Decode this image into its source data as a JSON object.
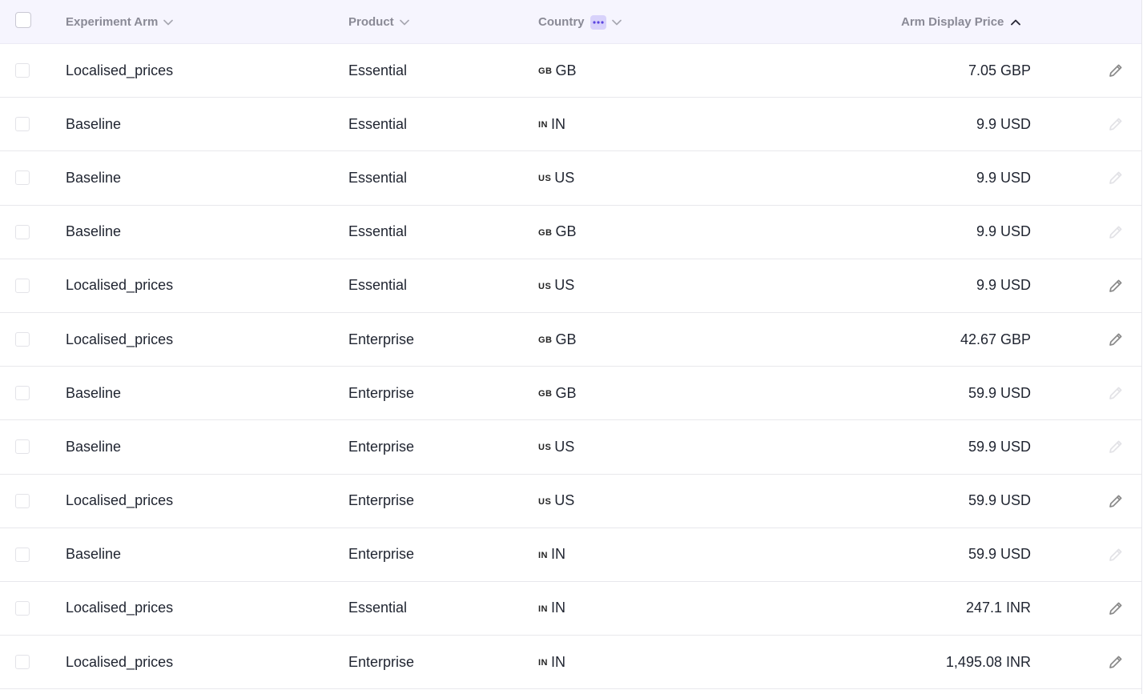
{
  "header": {
    "columns": {
      "arm": "Experiment Arm",
      "product": "Product",
      "country": "Country",
      "price": "Arm Display Price"
    }
  },
  "colors": {
    "header_bg": "#f6f5fe",
    "header_text": "#8a8a96",
    "accent": "#6c5ce7",
    "edit_active": "#888888",
    "edit_disabled": "#e2e2e6"
  },
  "rows": [
    {
      "arm": "Localised_prices",
      "product": "Essential",
      "flag": "GB",
      "country": "GB",
      "price": "7.05 GBP",
      "editable": true
    },
    {
      "arm": "Baseline",
      "product": "Essential",
      "flag": "IN",
      "country": "IN",
      "price": "9.9 USD",
      "editable": false
    },
    {
      "arm": "Baseline",
      "product": "Essential",
      "flag": "US",
      "country": "US",
      "price": "9.9 USD",
      "editable": false
    },
    {
      "arm": "Baseline",
      "product": "Essential",
      "flag": "GB",
      "country": "GB",
      "price": "9.9 USD",
      "editable": false
    },
    {
      "arm": "Localised_prices",
      "product": "Essential",
      "flag": "US",
      "country": "US",
      "price": "9.9 USD",
      "editable": true
    },
    {
      "arm": "Localised_prices",
      "product": "Enterprise",
      "flag": "GB",
      "country": "GB",
      "price": "42.67 GBP",
      "editable": true
    },
    {
      "arm": "Baseline",
      "product": "Enterprise",
      "flag": "GB",
      "country": "GB",
      "price": "59.9 USD",
      "editable": false
    },
    {
      "arm": "Baseline",
      "product": "Enterprise",
      "flag": "US",
      "country": "US",
      "price": "59.9 USD",
      "editable": false
    },
    {
      "arm": "Localised_prices",
      "product": "Enterprise",
      "flag": "US",
      "country": "US",
      "price": "59.9 USD",
      "editable": true
    },
    {
      "arm": "Baseline",
      "product": "Enterprise",
      "flag": "IN",
      "country": "IN",
      "price": "59.9 USD",
      "editable": false
    },
    {
      "arm": "Localised_prices",
      "product": "Essential",
      "flag": "IN",
      "country": "IN",
      "price": "247.1 INR",
      "editable": true
    },
    {
      "arm": "Localised_prices",
      "product": "Enterprise",
      "flag": "IN",
      "country": "IN",
      "price": "1,495.08 INR",
      "editable": true
    }
  ]
}
